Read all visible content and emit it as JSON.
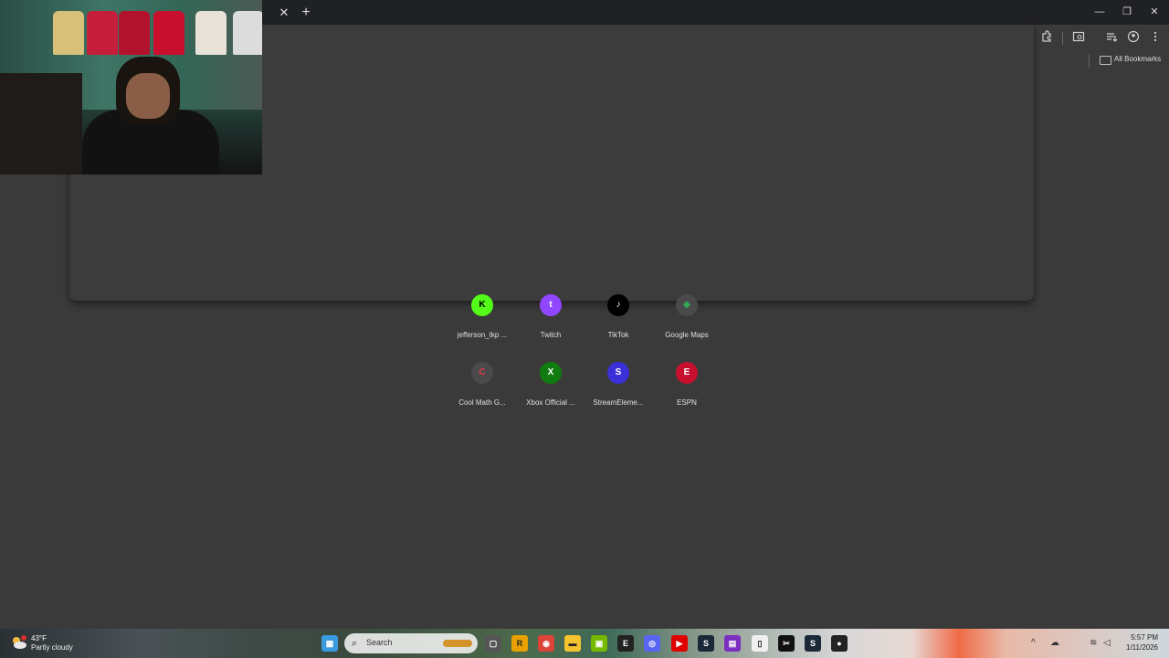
{
  "titlebar": {
    "close_tab": "✕",
    "new_tab": "+",
    "minimize": "—",
    "restore": "❐",
    "close": "✕"
  },
  "toolbar": {
    "icons": [
      "extensions-icon",
      "tab-search-icon",
      "reading-list-icon",
      "profile-icon",
      "menu-icon"
    ]
  },
  "bookmarks": {
    "all_bookmarks": "All Bookmarks"
  },
  "shortcuts": [
    {
      "label": "jefferson_tkp ...",
      "icon": "kick-icon",
      "glyph": "K",
      "color": "#53fc18",
      "fg": "#000000"
    },
    {
      "label": "Twitch",
      "icon": "twitch-icon",
      "glyph": "t",
      "color": "#9146ff",
      "fg": "#ffffff"
    },
    {
      "label": "TikTok",
      "icon": "tiktok-icon",
      "glyph": "♪",
      "color": "#000000",
      "fg": "#ffffff"
    },
    {
      "label": "Google Maps",
      "icon": "google-maps-icon",
      "glyph": "◆",
      "color": "#4a4a4a",
      "fg": "#34a853"
    },
    {
      "label": "Cool Math G...",
      "icon": "coolmath-icon",
      "glyph": "C",
      "color": "#4a4a4a",
      "fg": "#e63946"
    },
    {
      "label": "Xbox Official ...",
      "icon": "xbox-icon",
      "glyph": "X",
      "color": "#107c10",
      "fg": "#ffffff"
    },
    {
      "label": "StreamEleme...",
      "icon": "streamelements-icon",
      "glyph": "S",
      "color": "#3b2fd8",
      "fg": "#ffffff"
    },
    {
      "label": "ESPN",
      "icon": "espn-icon",
      "glyph": "E",
      "color": "#c8102e",
      "fg": "#ffffff"
    }
  ],
  "taskbar": {
    "weather": {
      "temp": "43°F",
      "condition": "Partly cloudy",
      "badge": "2"
    },
    "search_placeholder": "Search",
    "apps": [
      {
        "name": "widgets-icon",
        "glyph": "▦",
        "color": "#3a9be0"
      },
      {
        "name": "task-view-icon",
        "glyph": "▢",
        "color": "#555555"
      },
      {
        "name": "rockstar-icon",
        "glyph": "R",
        "color": "#e8a100"
      },
      {
        "name": "chrome-icon",
        "glyph": "◉",
        "color": "#db4437"
      },
      {
        "name": "file-explorer-icon",
        "glyph": "▬",
        "color": "#f4c430"
      },
      {
        "name": "nvidia-icon",
        "glyph": "▣",
        "color": "#76b900"
      },
      {
        "name": "epic-games-icon",
        "glyph": "E",
        "color": "#222222"
      },
      {
        "name": "discord-icon",
        "glyph": "◎",
        "color": "#5865f2"
      },
      {
        "name": "youtube-icon",
        "glyph": "▶",
        "color": "#e00000"
      },
      {
        "name": "steam-icon",
        "glyph": "S",
        "color": "#1b2838"
      },
      {
        "name": "video-editor-icon",
        "glyph": "▤",
        "color": "#7b2fbf"
      },
      {
        "name": "notepad-icon",
        "glyph": "▯",
        "color": "#f0f0f0"
      },
      {
        "name": "capcut-icon",
        "glyph": "✂",
        "color": "#111111"
      },
      {
        "name": "steam-2-icon",
        "glyph": "S",
        "color": "#1b2838"
      },
      {
        "name": "obs-icon",
        "glyph": "●",
        "color": "#222222"
      }
    ],
    "clock": {
      "time": "5:57 PM",
      "date": "1/11/2026"
    }
  }
}
